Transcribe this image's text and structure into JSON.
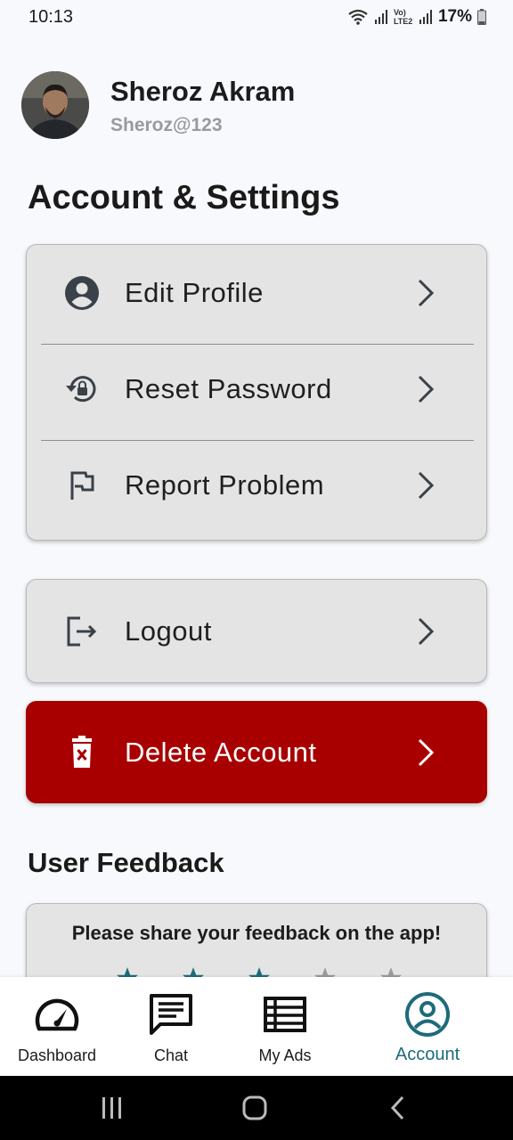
{
  "status_bar": {
    "time": "10:13",
    "network_label": "Vo) LTE2",
    "battery": "17%"
  },
  "profile": {
    "name": "Sheroz Akram",
    "handle": "Sheroz@123"
  },
  "settings": {
    "title": "Account & Settings",
    "items": [
      {
        "label": "Edit Profile",
        "icon": "account-circle-icon"
      },
      {
        "label": "Reset Password",
        "icon": "lock-reset-icon"
      },
      {
        "label": "Report Problem",
        "icon": "flag-icon"
      }
    ],
    "logout_label": "Logout",
    "delete_label": "Delete Account"
  },
  "feedback": {
    "title": "User Feedback",
    "prompt": "Please share your feedback on the app!",
    "rating": 3,
    "max_rating": 5
  },
  "bottom_nav": {
    "items": [
      {
        "label": "Dashboard",
        "icon": "speedometer-icon"
      },
      {
        "label": "Chat",
        "icon": "chat-icon"
      },
      {
        "label": "My Ads",
        "icon": "list-icon"
      },
      {
        "label": "Account",
        "icon": "account-circle-icon"
      }
    ],
    "active": "Account"
  },
  "colors": {
    "accent": "#1d6b7a",
    "danger": "#a80000",
    "card": "#e4e4e4",
    "star_active": "#1d6b7a",
    "star_inactive": "#9a9a9a"
  }
}
